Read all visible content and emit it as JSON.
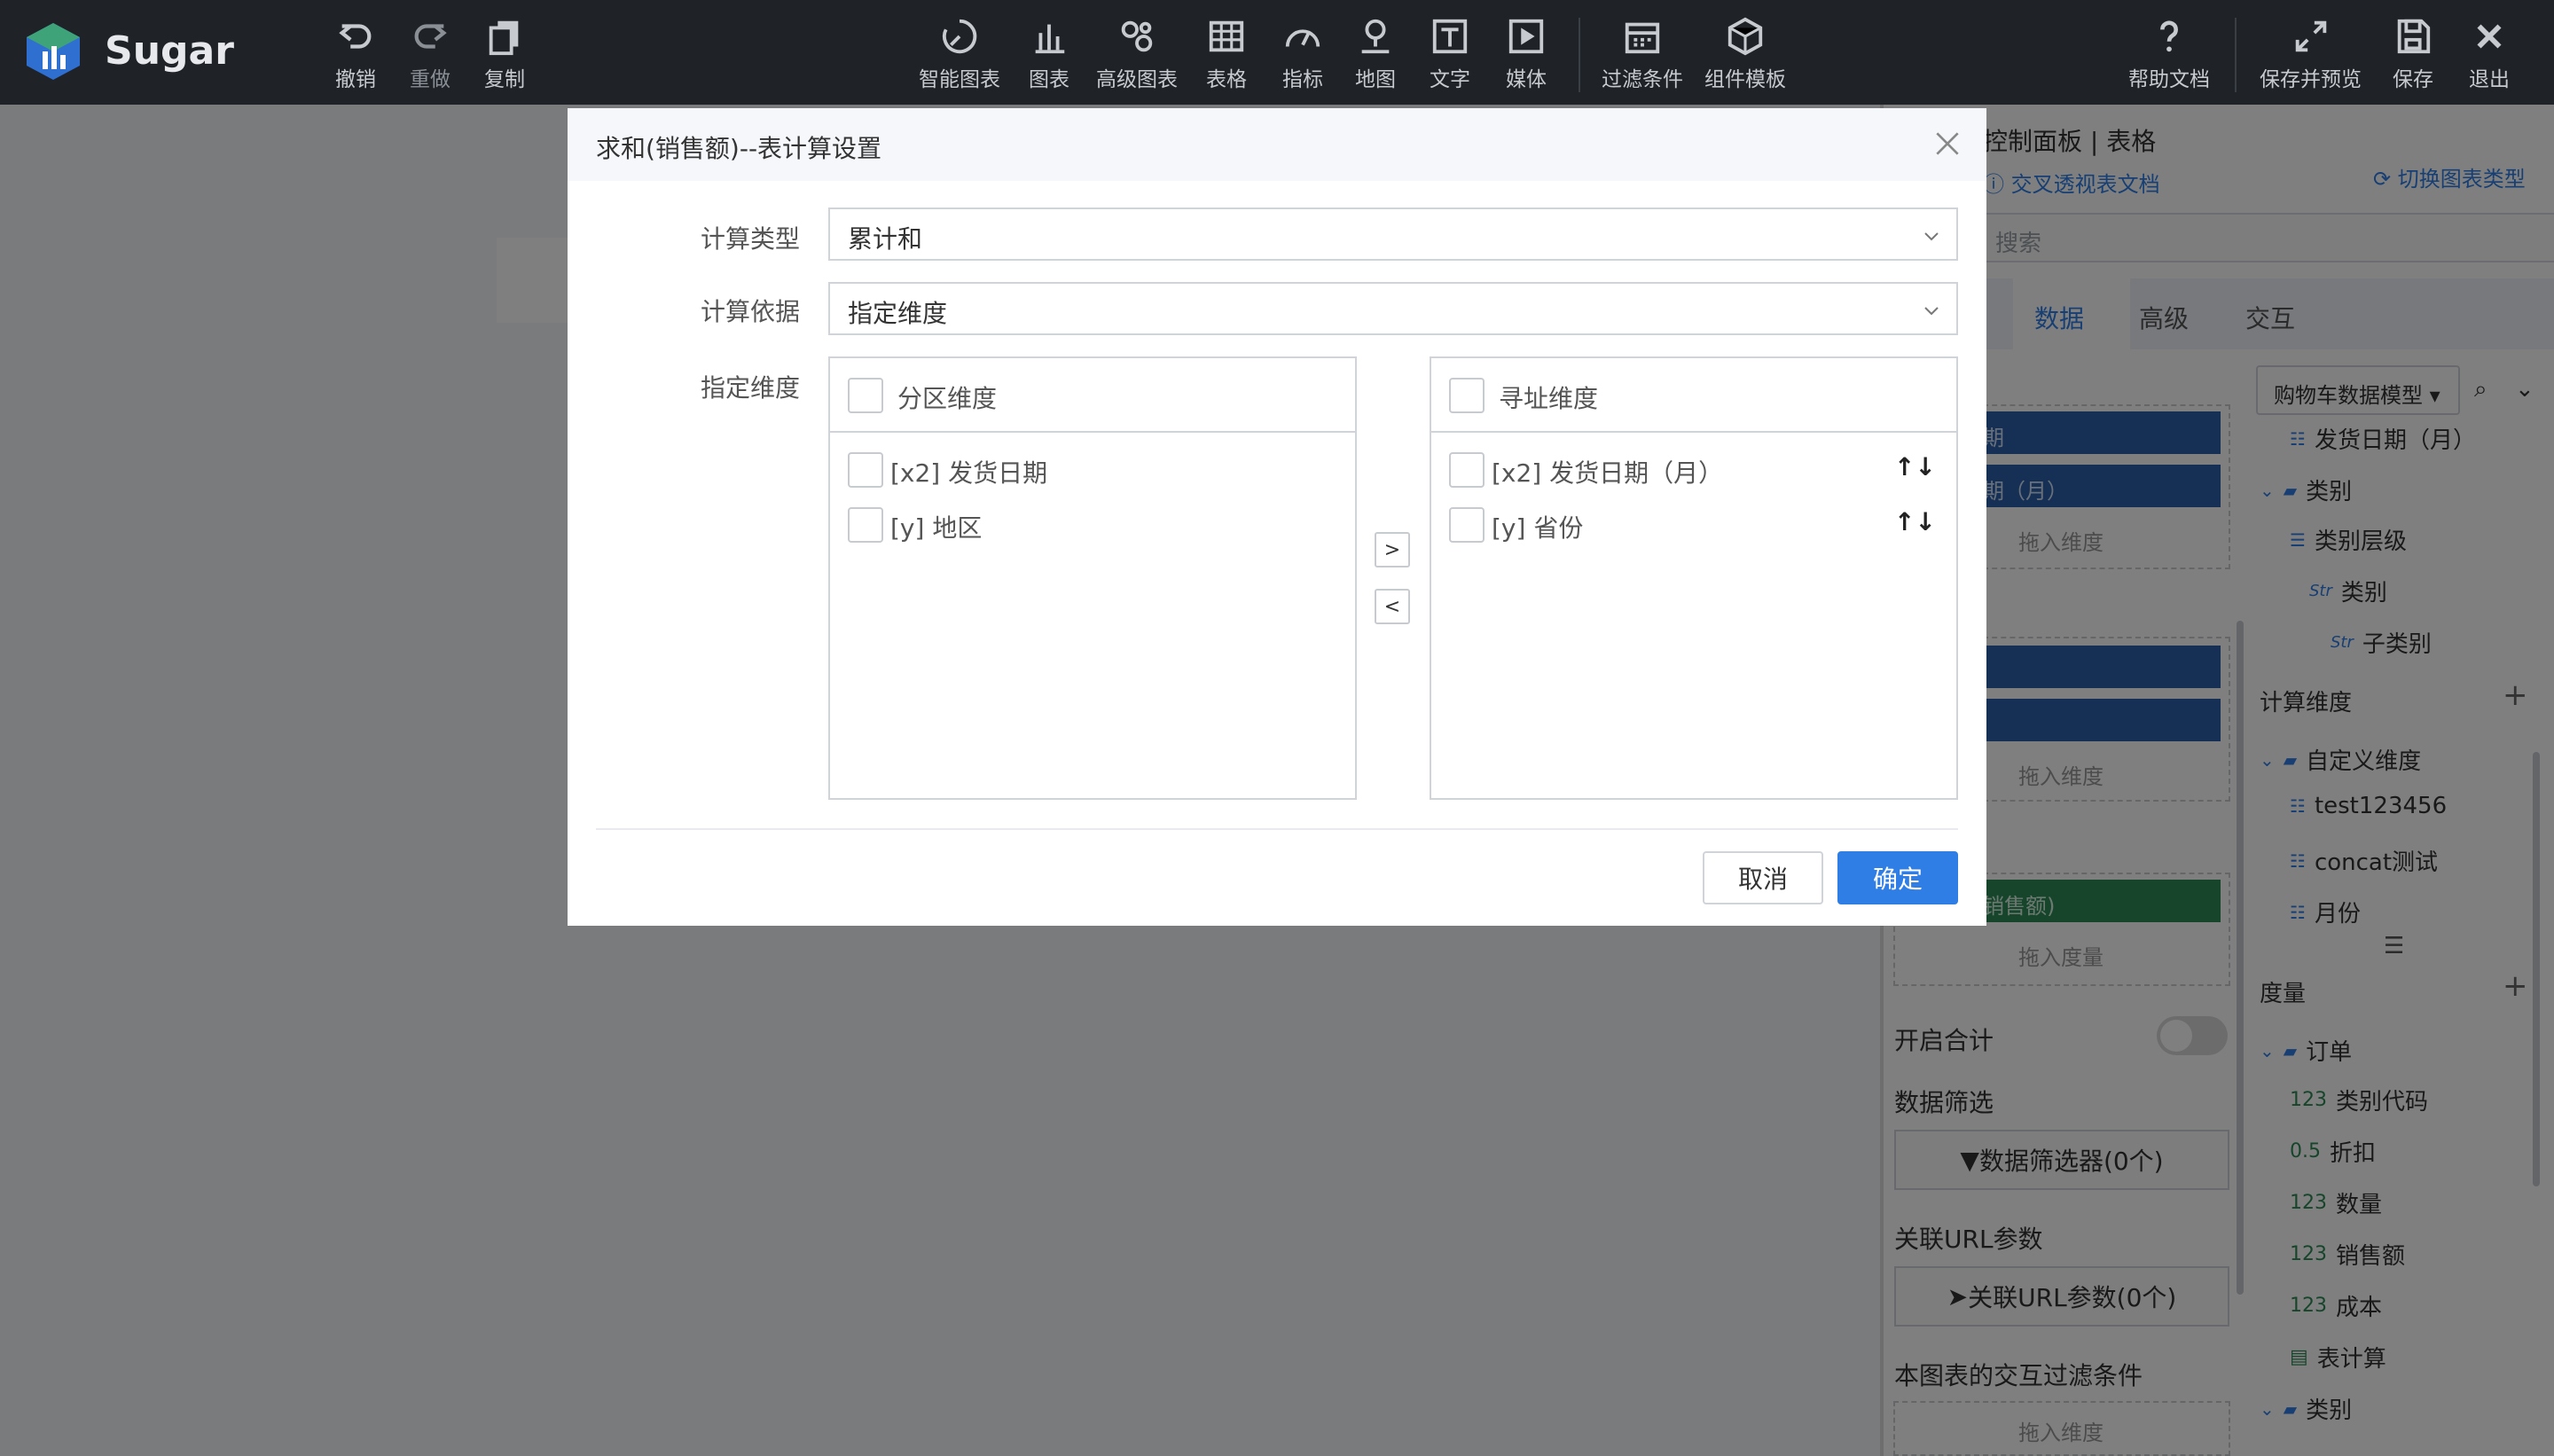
{
  "app": {
    "brand": "Sugar"
  },
  "toolbar": {
    "undo": "撤销",
    "redo": "重做",
    "copy": "复制",
    "smart_chart": "智能图表",
    "chart": "图表",
    "advanced_chart": "高级图表",
    "table": "表格",
    "indicator": "指标",
    "map": "地图",
    "text": "文字",
    "media": "媒体",
    "filter": "过滤条件",
    "component_template": "组件模板",
    "help": "帮助文档",
    "save_preview": "保存并预览",
    "save": "保存",
    "exit": "退出"
  },
  "panel": {
    "title": "控制面板 | 表格",
    "doc_link": "交叉透视表文档",
    "switch_type": "切换图表类型",
    "search_placeholder": "搜索",
    "tabs": [
      "数据",
      "高级",
      "交互"
    ],
    "pill_1": "期",
    "pill_2": "期（月）",
    "drop_dimension": "拖入维度",
    "pill_measure": "销售额)",
    "drop_measure": "拖入度量",
    "enable_total": "开启合计",
    "data_filter_label": "数据筛选",
    "data_filter_btn": "数据筛选器(0个)",
    "url_param_label": "关联URL参数",
    "url_param_btn": "关联URL参数(0个)",
    "interaction_filter_label": "本图表的交互过滤条件",
    "model": "购物车数据模型",
    "tree": {
      "ship_month": "发货日期（月）",
      "category_folder": "类别",
      "category_level": "类别层级",
      "category": "类别",
      "subcategory": "子类别",
      "calc_dim_section": "计算维度",
      "custom_dim_folder": "自定义维度",
      "test": "test123456",
      "concat": "concat测试",
      "month": "月份",
      "measure_section": "度量",
      "order_folder": "订单",
      "category_code": "类别代码",
      "discount": "折扣",
      "quantity": "数量",
      "sales": "销售额",
      "cost": "成本",
      "table_calc": "表计算",
      "category_folder_2": "类别"
    },
    "icon_labels": {
      "num": "123",
      "dec": "0.5",
      "str": "Str"
    }
  },
  "modal": {
    "title": "求和(销售额)--表计算设置",
    "calc_type_label": "计算类型",
    "calc_type_value": "累计和",
    "calc_basis_label": "计算依据",
    "calc_basis_value": "指定维度",
    "dims_label": "指定维度",
    "partition": {
      "header": "分区维度",
      "items": [
        "[x2] 发货日期",
        "[y] 地区"
      ]
    },
    "addressing": {
      "header": "寻址维度",
      "items": [
        "[x2] 发货日期（月）",
        "[y] 省份"
      ]
    },
    "move_right": ">",
    "move_left": "<",
    "cancel": "取消",
    "confirm": "确定"
  },
  "colors": {
    "accent": "#2f7ee6",
    "toolbar_bg": "#1f2227",
    "pill_blue": "#2d5fa8",
    "pill_green": "#2e8b57"
  }
}
